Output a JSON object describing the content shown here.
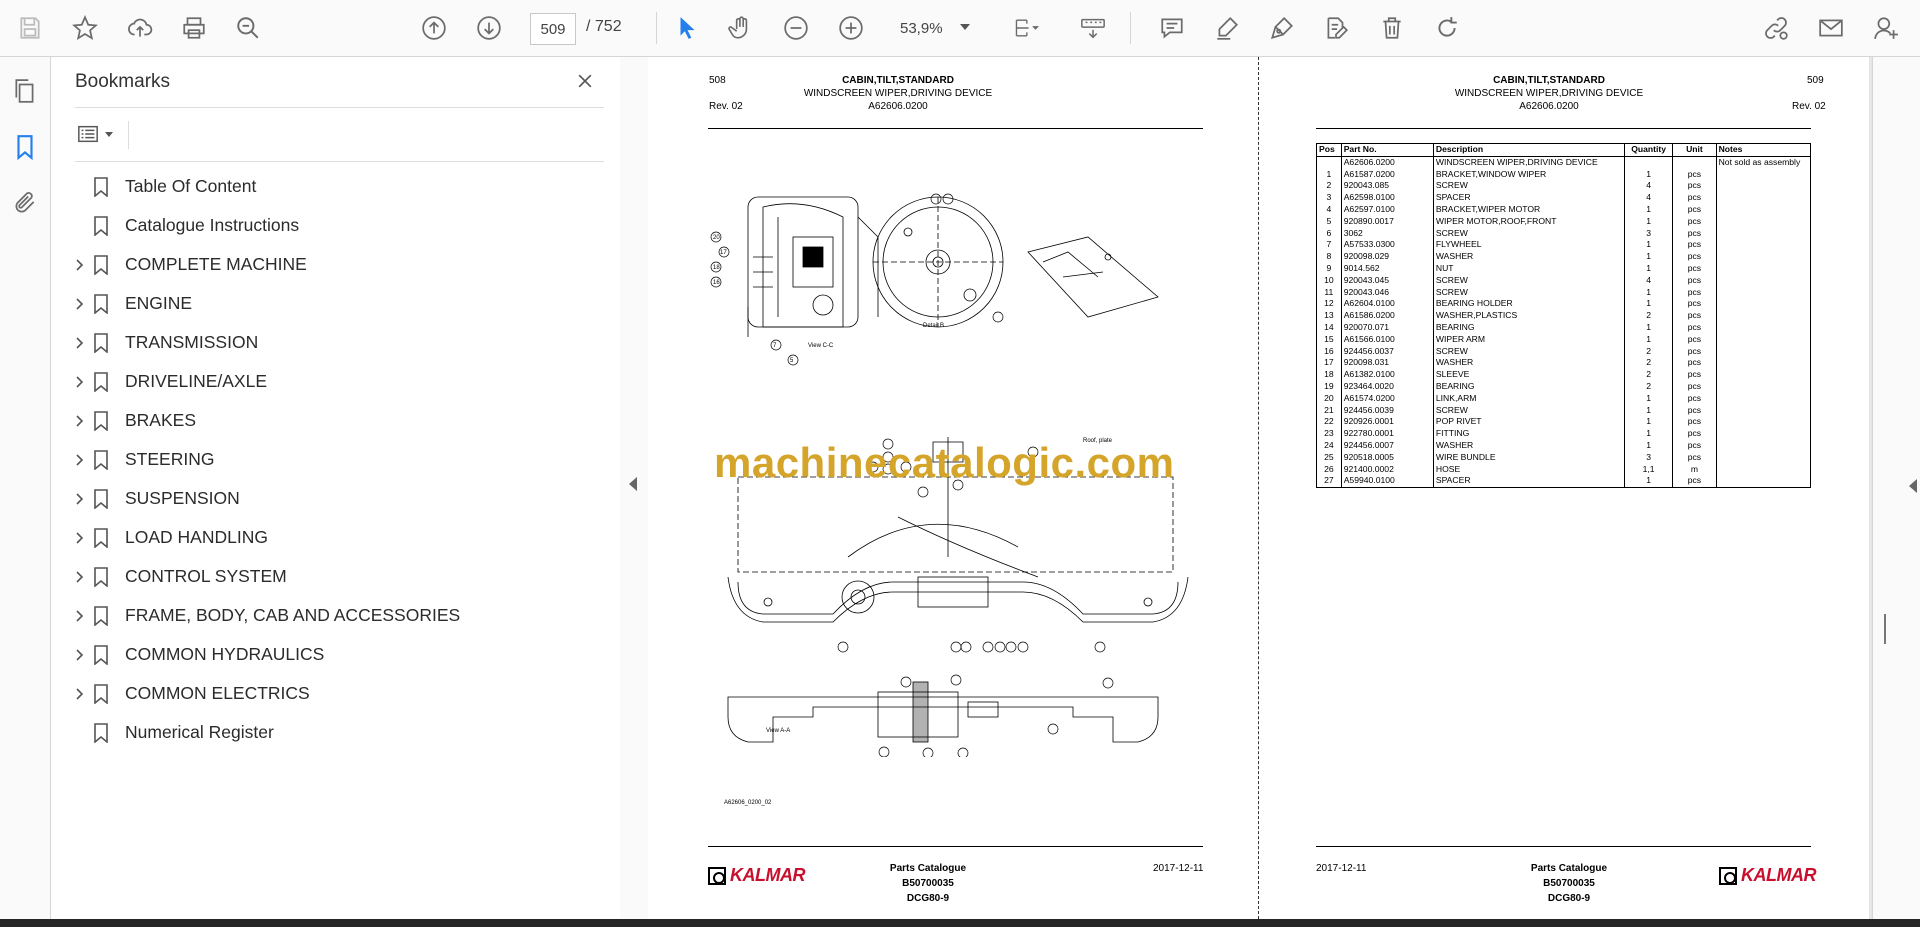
{
  "toolbar": {
    "page_current": "509",
    "page_total": "/ 752",
    "zoom": "53,9%"
  },
  "bookmarks": {
    "title": "Bookmarks",
    "items": [
      {
        "label": "Table Of Content",
        "expandable": false
      },
      {
        "label": "Catalogue Instructions",
        "expandable": false
      },
      {
        "label": "COMPLETE MACHINE",
        "expandable": true
      },
      {
        "label": "ENGINE",
        "expandable": true
      },
      {
        "label": "TRANSMISSION",
        "expandable": true
      },
      {
        "label": "DRIVELINE/AXLE",
        "expandable": true
      },
      {
        "label": "BRAKES",
        "expandable": true
      },
      {
        "label": "STEERING",
        "expandable": true
      },
      {
        "label": "SUSPENSION",
        "expandable": true
      },
      {
        "label": "LOAD HANDLING",
        "expandable": true
      },
      {
        "label": "CONTROL SYSTEM",
        "expandable": true
      },
      {
        "label": "FRAME, BODY, CAB AND ACCESSORIES",
        "expandable": true
      },
      {
        "label": "COMMON HYDRAULICS",
        "expandable": true
      },
      {
        "label": "COMMON ELECTRICS",
        "expandable": true
      },
      {
        "label": "Numerical Register",
        "expandable": false
      }
    ]
  },
  "left_page": {
    "page_no": "508",
    "title1": "CABIN,TILT,STANDARD",
    "title2": "WINDSCREEN WIPER,DRIVING DEVICE",
    "code": "A62606.0200",
    "rev": "Rev. 02",
    "drawing_ref": "A62606_0200_02",
    "label_view_cc": "View C-C",
    "label_detail_b": "Detail B",
    "label_view_aa": "View A-A",
    "label_roof_plate": "Roof, plate",
    "watermark": "machinecatalogic.com",
    "footer_title": "Parts Catalogue",
    "footer_no": "B50700035",
    "footer_model": "DCG80-9",
    "footer_date": "2017-12-11",
    "logo": "KALMAR"
  },
  "right_page": {
    "page_no": "509",
    "title1": "CABIN,TILT,STANDARD",
    "title2": "WINDSCREEN WIPER,DRIVING DEVICE",
    "code": "A62606.0200",
    "rev": "Rev. 02",
    "footer_title": "Parts Catalogue",
    "footer_no": "B50700035",
    "footer_model": "DCG80-9",
    "footer_date": "2017-12-11",
    "logo": "KALMAR",
    "table_headers": [
      "Pos",
      "Part No.",
      "Description",
      "Quantity",
      "Unit",
      "Notes"
    ],
    "rows": [
      [
        "",
        "A62606.0200",
        "WINDSCREEN WIPER,DRIVING DEVICE",
        "",
        "",
        "Not sold as assembly"
      ],
      [
        "1",
        "A61587.0200",
        "BRACKET,WINDOW WIPER",
        "1",
        "pcs",
        ""
      ],
      [
        "2",
        "920043.085",
        "SCREW",
        "4",
        "pcs",
        ""
      ],
      [
        "3",
        "A62598.0100",
        "SPACER",
        "4",
        "pcs",
        ""
      ],
      [
        "4",
        "A62597.0100",
        "BRACKET,WIPER MOTOR",
        "1",
        "pcs",
        ""
      ],
      [
        "5",
        "920890.0017",
        "WIPER MOTOR,ROOF,FRONT",
        "1",
        "pcs",
        ""
      ],
      [
        "6",
        "3062",
        "SCREW",
        "3",
        "pcs",
        ""
      ],
      [
        "7",
        "A57533.0300",
        "FLYWHEEL",
        "1",
        "pcs",
        ""
      ],
      [
        "8",
        "920098.029",
        "WASHER",
        "1",
        "pcs",
        ""
      ],
      [
        "9",
        "9014.562",
        "NUT",
        "1",
        "pcs",
        ""
      ],
      [
        "10",
        "920043.045",
        "SCREW",
        "4",
        "pcs",
        ""
      ],
      [
        "11",
        "920043.046",
        "SCREW",
        "1",
        "pcs",
        ""
      ],
      [
        "12",
        "A62604.0100",
        "BEARING HOLDER",
        "1",
        "pcs",
        ""
      ],
      [
        "13",
        "A61586.0200",
        "WASHER,PLASTICS",
        "2",
        "pcs",
        ""
      ],
      [
        "14",
        "920070.071",
        "BEARING",
        "1",
        "pcs",
        ""
      ],
      [
        "15",
        "A61566.0100",
        "WIPER ARM",
        "1",
        "pcs",
        ""
      ],
      [
        "16",
        "924456.0037",
        "SCREW",
        "2",
        "pcs",
        ""
      ],
      [
        "17",
        "920098.031",
        "WASHER",
        "2",
        "pcs",
        ""
      ],
      [
        "18",
        "A61382.0100",
        "SLEEVE",
        "2",
        "pcs",
        ""
      ],
      [
        "19",
        "923464.0020",
        "BEARING",
        "2",
        "pcs",
        ""
      ],
      [
        "20",
        "A61574.0200",
        "LINK,ARM",
        "1",
        "pcs",
        ""
      ],
      [
        "21",
        "924456.0039",
        "SCREW",
        "1",
        "pcs",
        ""
      ],
      [
        "22",
        "920926.0001",
        "POP RIVET",
        "1",
        "pcs",
        ""
      ],
      [
        "23",
        "922780.0001",
        "FITTING",
        "1",
        "pcs",
        ""
      ],
      [
        "24",
        "924456.0007",
        "WASHER",
        "1",
        "pcs",
        ""
      ],
      [
        "25",
        "920518.0005",
        "WIRE BUNDLE",
        "3",
        "pcs",
        ""
      ],
      [
        "26",
        "921400.0002",
        "HOSE",
        "1,1",
        "m",
        ""
      ],
      [
        "27",
        "A59940.0100",
        "SPACER",
        "1",
        "pcs",
        ""
      ]
    ]
  }
}
